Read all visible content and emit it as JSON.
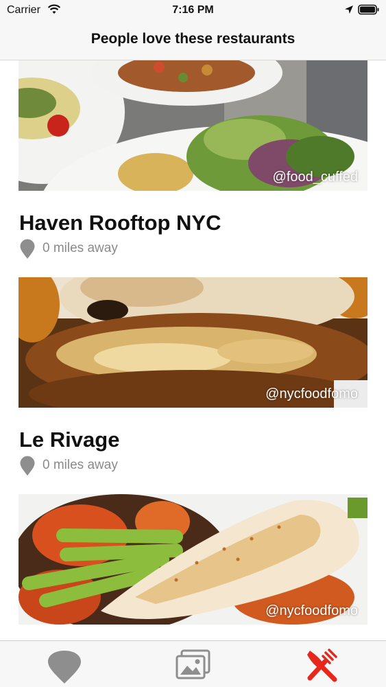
{
  "status_bar": {
    "carrier": "Carrier",
    "time": "7:16 PM",
    "icons": [
      "wifi-icon",
      "location-arrow-icon",
      "battery-icon"
    ]
  },
  "nav": {
    "title": "People love these restaurants"
  },
  "feed": {
    "items": [
      {
        "credit": "@food_cuffed",
        "name": "Haven Rooftop NYC",
        "distance": "0 miles away",
        "photo": "quiche-and-salad-plates"
      },
      {
        "credit": "@nycfoodfomo",
        "name": "Le Rivage",
        "distance": "0 miles away",
        "photo": "burger-with-melted-cheese"
      },
      {
        "credit": "@nycfoodfomo",
        "photo": "lobster-tail-with-asparagus"
      }
    ]
  },
  "tab_bar": {
    "tabs": [
      {
        "icon": "map-pin-icon",
        "active": false
      },
      {
        "icon": "photo-gallery-icon",
        "active": false
      },
      {
        "icon": "fork-knife-icon",
        "active": true
      }
    ]
  },
  "colors": {
    "bar_background": "#f7f7f7",
    "secondary_text": "#8a8a8a",
    "active_tab": "#e8271c",
    "inactive_tab": "#8e8e8e"
  }
}
